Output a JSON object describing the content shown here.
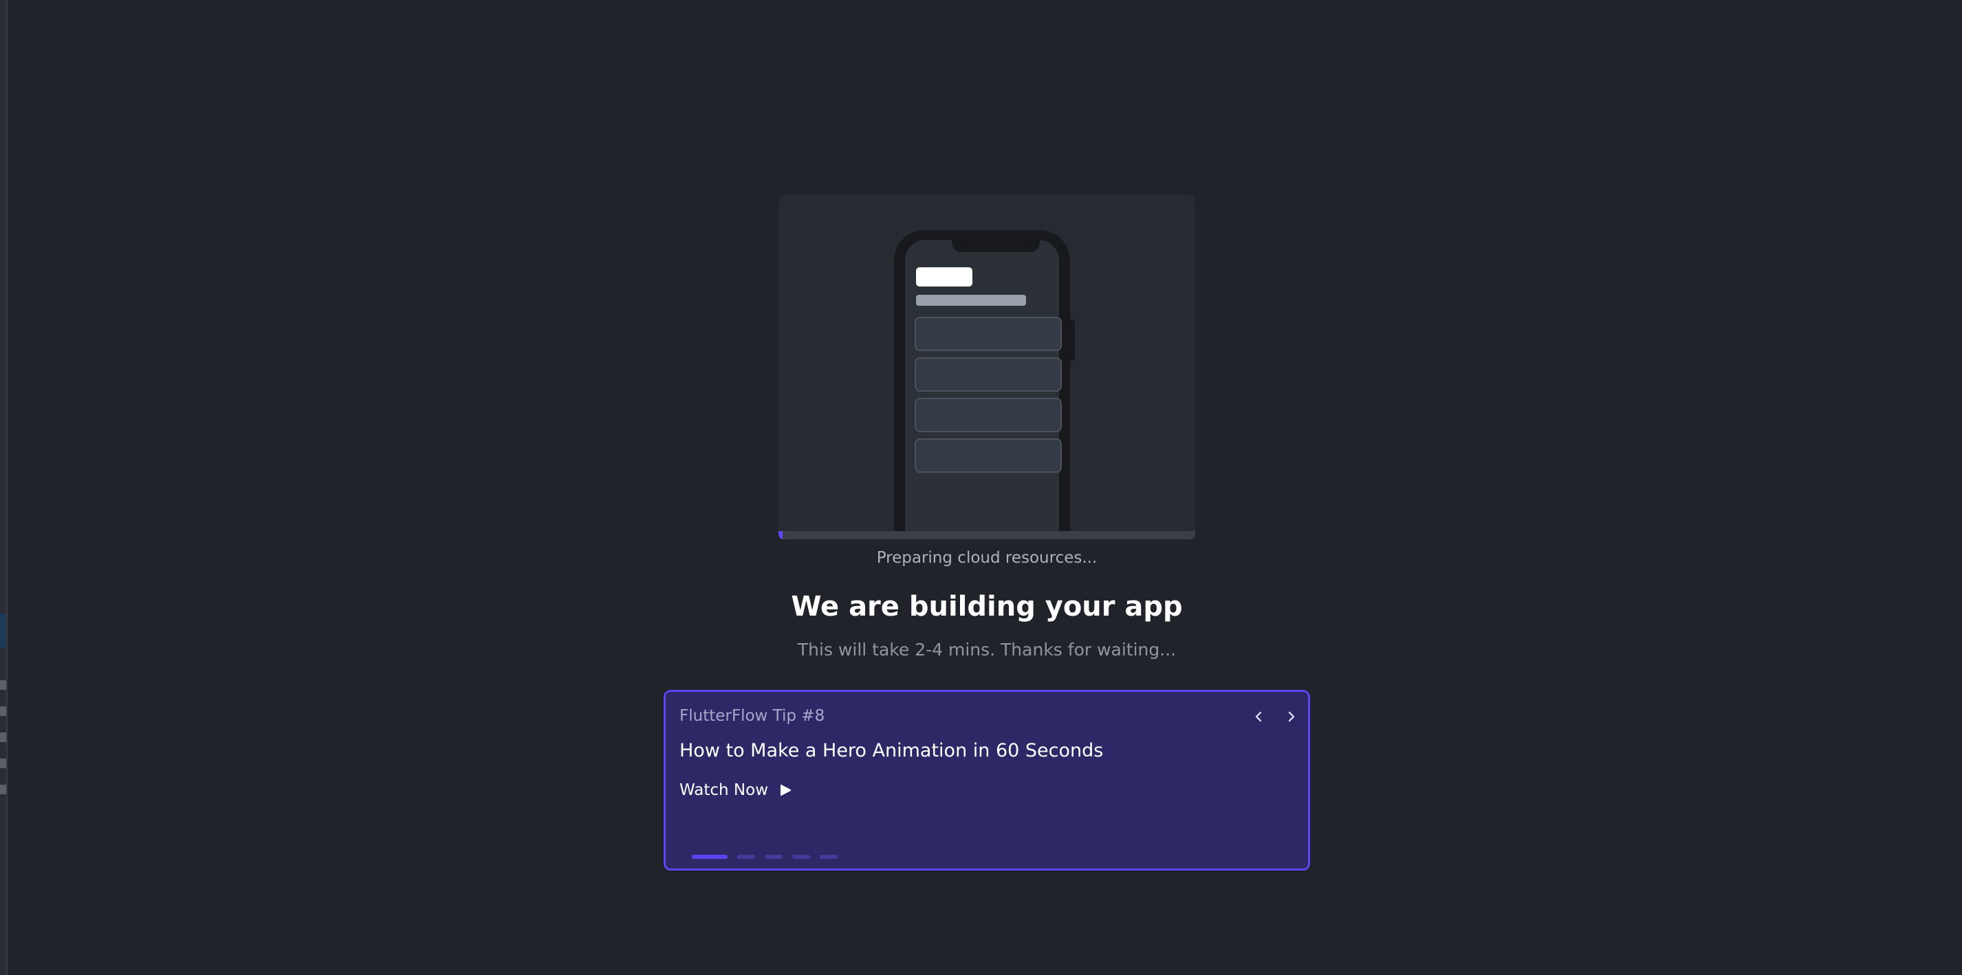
{
  "build": {
    "status_text": "Preparing cloud resources...",
    "progress_fraction": 0.01,
    "title": "We are building your app",
    "subtitle": "This will take 2-4 mins. Thanks for waiting..."
  },
  "tip": {
    "label": "FlutterFlow Tip #8",
    "title": "How to Make a Hero Animation in 60 Seconds",
    "action_label": "Watch Now",
    "action_icon": "play-icon",
    "prev_icon": "chevron-left-icon",
    "next_icon": "chevron-right-icon",
    "pager": {
      "total": 5,
      "active_index": 0
    }
  },
  "colors": {
    "background": "#202329",
    "accent": "#5a45f0",
    "card_background": "#2d2866"
  }
}
